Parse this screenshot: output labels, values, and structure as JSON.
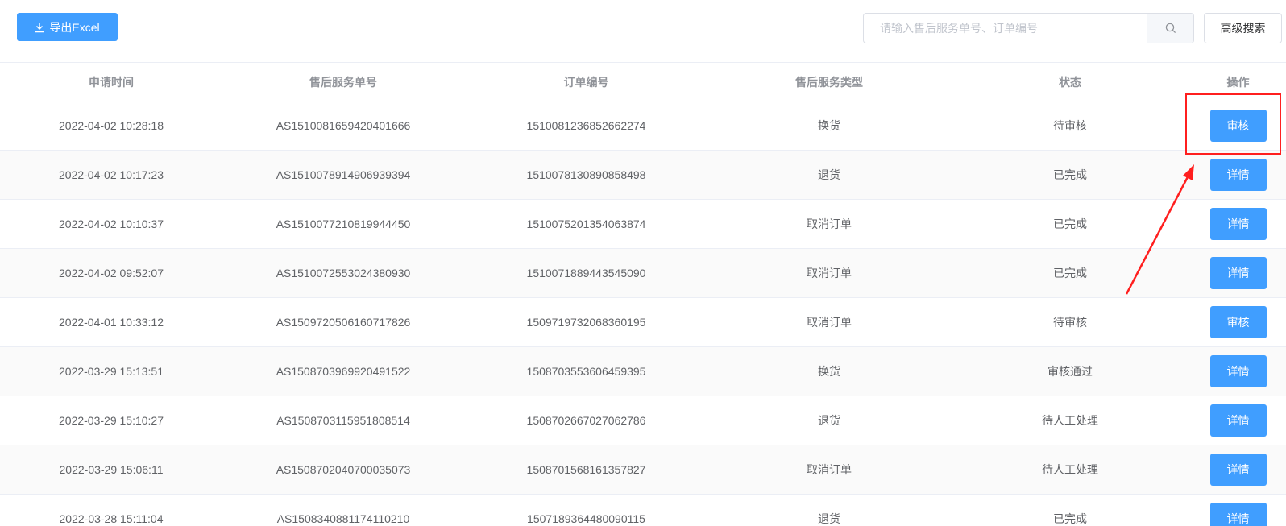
{
  "toolbar": {
    "export_label": "导出Excel",
    "export_icon": "download-icon",
    "search_placeholder": "请输入售后服务单号、订单编号",
    "search_value": "",
    "search_icon": "search-icon",
    "advanced_search_label": "高级搜索"
  },
  "table": {
    "headers": [
      "申请时间",
      "售后服务单号",
      "订单编号",
      "售后服务类型",
      "状态",
      "操作"
    ],
    "rows": [
      {
        "time": "2022-04-02 10:28:18",
        "service_no": "AS1510081659420401666",
        "order_no": "1510081236852662274",
        "type": "换货",
        "status": "待审核",
        "action": "审核"
      },
      {
        "time": "2022-04-02 10:17:23",
        "service_no": "AS1510078914906939394",
        "order_no": "1510078130890858498",
        "type": "退货",
        "status": "已完成",
        "action": "详情"
      },
      {
        "time": "2022-04-02 10:10:37",
        "service_no": "AS1510077210819944450",
        "order_no": "1510075201354063874",
        "type": "取消订单",
        "status": "已完成",
        "action": "详情"
      },
      {
        "time": "2022-04-02 09:52:07",
        "service_no": "AS1510072553024380930",
        "order_no": "1510071889443545090",
        "type": "取消订单",
        "status": "已完成",
        "action": "详情"
      },
      {
        "time": "2022-04-01 10:33:12",
        "service_no": "AS1509720506160717826",
        "order_no": "1509719732068360195",
        "type": "取消订单",
        "status": "待审核",
        "action": "审核"
      },
      {
        "time": "2022-03-29 15:13:51",
        "service_no": "AS1508703969920491522",
        "order_no": "1508703553606459395",
        "type": "换货",
        "status": "审核通过",
        "action": "详情"
      },
      {
        "time": "2022-03-29 15:10:27",
        "service_no": "AS1508703115951808514",
        "order_no": "1508702667027062786",
        "type": "退货",
        "status": "待人工处理",
        "action": "详情"
      },
      {
        "time": "2022-03-29 15:06:11",
        "service_no": "AS1508702040700035073",
        "order_no": "1508701568161357827",
        "type": "取消订单",
        "status": "待人工处理",
        "action": "详情"
      },
      {
        "time": "2022-03-28 15:11:04",
        "service_no": "AS1508340881174110210",
        "order_no": "1507189364480090115",
        "type": "退货",
        "status": "已完成",
        "action": "详情"
      }
    ]
  },
  "colors": {
    "primary": "#409eff",
    "annotation": "#ff1f1f",
    "border": "#ebeef5",
    "header_text": "#909399",
    "body_text": "#606266"
  }
}
